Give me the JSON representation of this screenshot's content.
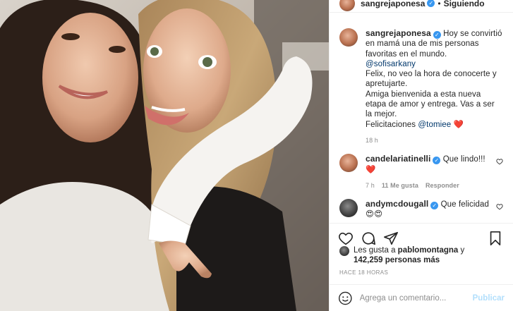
{
  "post": {
    "author": "sangrejaponesa",
    "follow_status": "Siguiendo",
    "dot": "•",
    "verified_mark": "✓"
  },
  "caption": {
    "author": "sangrejaponesa",
    "text": "Hoy se convirtió en mamá una de mis personas favoritas en el mundo.",
    "mention": "@sofisarkany",
    "line2": "Felix, no veo la hora de conocerte y apretujarte.",
    "line3": "Amiga bienvenida a esta nueva etapa de amor y entrega. Vas a ser la mejor.",
    "line4_prefix": "Felicitaciones",
    "line4_mention": "@tomiee",
    "heart": "❤️",
    "time": "18 h"
  },
  "comments": [
    {
      "author": "candelariatinelli",
      "text": "Que lindo!!!",
      "emoji": "❤️",
      "time": "7 h",
      "likes": "11 Me gusta",
      "reply": "Responder"
    },
    {
      "author": "andymcdougall",
      "text": "Que felicidad",
      "emoji": "😍😍"
    }
  ],
  "likes": {
    "prefix": "Les gusta a",
    "user": "pablomontagna",
    "joiner": "y",
    "count": "142,259 personas más"
  },
  "time_ago": "HACE 18 HORAS",
  "add_comment": {
    "placeholder": "Agrega un comentario...",
    "publish": "Publicar"
  },
  "icons": [
    "heart-icon",
    "comment-icon",
    "share-icon",
    "bookmark-icon",
    "smile-icon"
  ]
}
